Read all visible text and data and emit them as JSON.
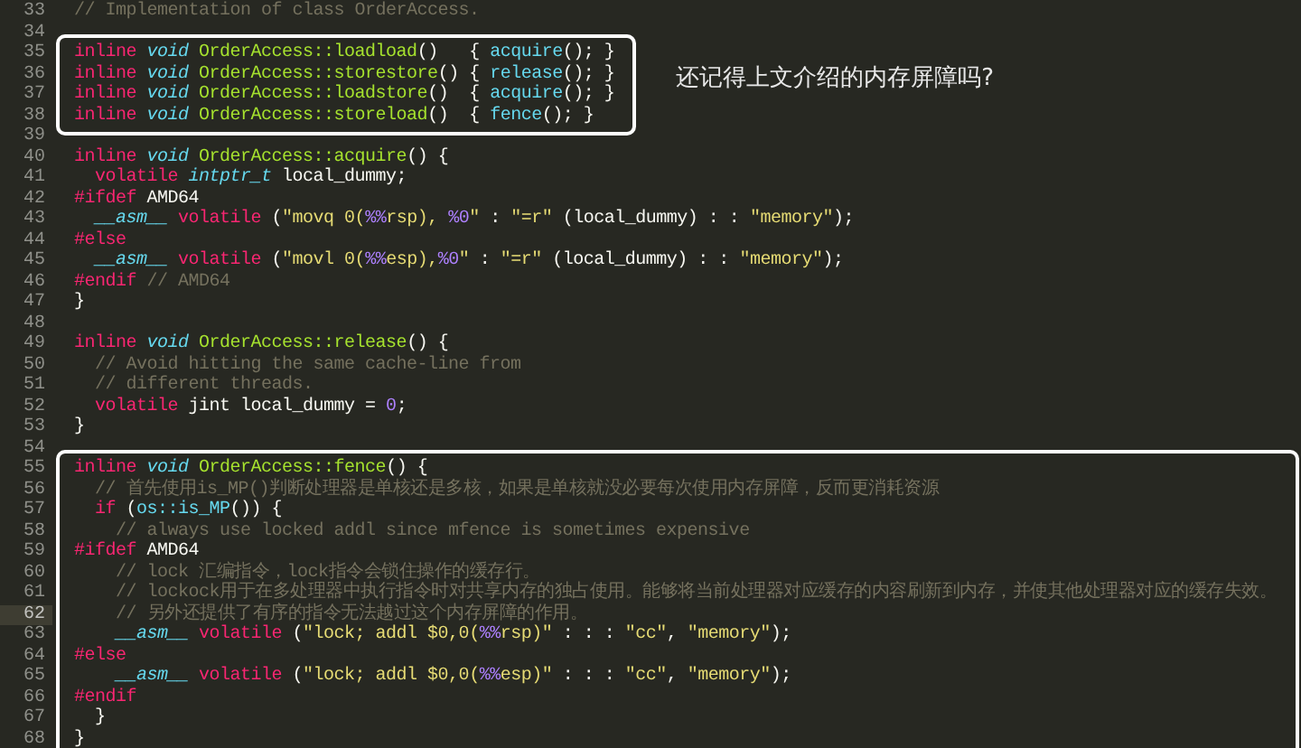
{
  "blocks": [
    {
      "framed": false,
      "lines": [
        {
          "number": "33",
          "current": false,
          "tokens": [
            {
              "kind": "comment",
              "text": "// Implementation of class OrderAccess."
            }
          ]
        },
        {
          "number": "34",
          "current": false
        }
      ]
    },
    {
      "framed": true,
      "note": "还记得上文介绍的内存屏障吗?",
      "lines": [
        {
          "number": "35",
          "current": false,
          "tokens": [
            {
              "kind": "keyword",
              "text": "inline "
            },
            {
              "kind": "type",
              "text": "void "
            },
            {
              "kind": "function",
              "text": "OrderAccess::loadload"
            },
            {
              "kind": "plain",
              "text": "()   { "
            },
            {
              "kind": "call",
              "text": "acquire"
            },
            {
              "kind": "plain",
              "text": "(); }"
            }
          ]
        },
        {
          "number": "36",
          "current": false,
          "tokens": [
            {
              "kind": "keyword",
              "text": "inline "
            },
            {
              "kind": "type",
              "text": "void "
            },
            {
              "kind": "function",
              "text": "OrderAccess::storestore"
            },
            {
              "kind": "plain",
              "text": "() { "
            },
            {
              "kind": "call",
              "text": "release"
            },
            {
              "kind": "plain",
              "text": "(); }"
            }
          ]
        },
        {
          "number": "37",
          "current": false,
          "tokens": [
            {
              "kind": "keyword",
              "text": "inline "
            },
            {
              "kind": "type",
              "text": "void "
            },
            {
              "kind": "function",
              "text": "OrderAccess::loadstore"
            },
            {
              "kind": "plain",
              "text": "()  { "
            },
            {
              "kind": "call",
              "text": "acquire"
            },
            {
              "kind": "plain",
              "text": "(); }"
            }
          ]
        },
        {
          "number": "38",
          "current": false,
          "tokens": [
            {
              "kind": "keyword",
              "text": "inline "
            },
            {
              "kind": "type",
              "text": "void "
            },
            {
              "kind": "function",
              "text": "OrderAccess::storeload"
            },
            {
              "kind": "plain",
              "text": "()  { "
            },
            {
              "kind": "call",
              "text": "fence"
            },
            {
              "kind": "plain",
              "text": "(); }"
            }
          ]
        }
      ]
    },
    {
      "framed": false,
      "lines": [
        {
          "number": "39",
          "current": false
        },
        {
          "number": "40",
          "current": false,
          "tokens": [
            {
              "kind": "keyword",
              "text": "inline "
            },
            {
              "kind": "type",
              "text": "void "
            },
            {
              "kind": "function",
              "text": "OrderAccess::acquire"
            },
            {
              "kind": "plain",
              "text": "() {"
            }
          ]
        },
        {
          "number": "41",
          "current": false,
          "tokens": [
            {
              "kind": "keyword",
              "text": "  volatile "
            },
            {
              "kind": "type",
              "text": "intptr_t "
            },
            {
              "kind": "plain",
              "text": "local_dummy;"
            }
          ]
        },
        {
          "number": "42",
          "current": false,
          "tokens": [
            {
              "kind": "keyword",
              "text": "#ifdef "
            },
            {
              "kind": "plain",
              "text": "AMD64"
            }
          ]
        },
        {
          "number": "43",
          "current": false,
          "tokens": [
            {
              "kind": "type",
              "text": "  __asm__ "
            },
            {
              "kind": "keyword",
              "text": "volatile "
            },
            {
              "kind": "plain",
              "text": "("
            },
            {
              "kind": "string",
              "text": "\"movq 0("
            },
            {
              "kind": "number",
              "text": "%%"
            },
            {
              "kind": "string",
              "text": "rsp), "
            },
            {
              "kind": "number",
              "text": "%0"
            },
            {
              "kind": "string",
              "text": "\""
            },
            {
              "kind": "plain",
              "text": " : "
            },
            {
              "kind": "string",
              "text": "\"=r\""
            },
            {
              "kind": "plain",
              "text": " (local_dummy) : : "
            },
            {
              "kind": "string",
              "text": "\"memory\""
            },
            {
              "kind": "plain",
              "text": ");"
            }
          ]
        },
        {
          "number": "44",
          "current": false,
          "tokens": [
            {
              "kind": "keyword",
              "text": "#else"
            }
          ]
        },
        {
          "number": "45",
          "current": false,
          "tokens": [
            {
              "kind": "type",
              "text": "  __asm__ "
            },
            {
              "kind": "keyword",
              "text": "volatile "
            },
            {
              "kind": "plain",
              "text": "("
            },
            {
              "kind": "string",
              "text": "\"movl 0("
            },
            {
              "kind": "number",
              "text": "%%"
            },
            {
              "kind": "string",
              "text": "esp),"
            },
            {
              "kind": "number",
              "text": "%0"
            },
            {
              "kind": "string",
              "text": "\""
            },
            {
              "kind": "plain",
              "text": " : "
            },
            {
              "kind": "string",
              "text": "\"=r\""
            },
            {
              "kind": "plain",
              "text": " (local_dummy) : : "
            },
            {
              "kind": "string",
              "text": "\"memory\""
            },
            {
              "kind": "plain",
              "text": ");"
            }
          ]
        },
        {
          "number": "46",
          "current": false,
          "tokens": [
            {
              "kind": "keyword",
              "text": "#endif"
            },
            {
              "kind": "comment",
              "text": " // AMD64"
            }
          ]
        },
        {
          "number": "47",
          "current": false,
          "tokens": [
            {
              "kind": "plain",
              "text": "}"
            }
          ]
        },
        {
          "number": "48",
          "current": false
        },
        {
          "number": "49",
          "current": false,
          "tokens": [
            {
              "kind": "keyword",
              "text": "inline "
            },
            {
              "kind": "type",
              "text": "void "
            },
            {
              "kind": "function",
              "text": "OrderAccess::release"
            },
            {
              "kind": "plain",
              "text": "() {"
            }
          ]
        },
        {
          "number": "50",
          "current": false,
          "tokens": [
            {
              "kind": "comment",
              "text": "  // Avoid hitting the same cache-line from"
            }
          ]
        },
        {
          "number": "51",
          "current": false,
          "tokens": [
            {
              "kind": "comment",
              "text": "  // different threads."
            }
          ]
        },
        {
          "number": "52",
          "current": false,
          "tokens": [
            {
              "kind": "keyword",
              "text": "  volatile"
            },
            {
              "kind": "plain",
              "text": " jint local_dummy = "
            },
            {
              "kind": "number",
              "text": "0"
            },
            {
              "kind": "plain",
              "text": ";"
            }
          ]
        },
        {
          "number": "53",
          "current": false,
          "tokens": [
            {
              "kind": "plain",
              "text": "}"
            }
          ]
        },
        {
          "number": "54",
          "current": false
        }
      ]
    },
    {
      "framed": true,
      "lines": [
        {
          "number": "55",
          "current": false,
          "tokens": [
            {
              "kind": "keyword",
              "text": "inline "
            },
            {
              "kind": "type",
              "text": "void "
            },
            {
              "kind": "function",
              "text": "OrderAccess::fence"
            },
            {
              "kind": "plain",
              "text": "() {"
            }
          ]
        },
        {
          "number": "56",
          "current": false,
          "tokens": [
            {
              "kind": "comment",
              "text": "  // 首先使用is_MP()判断处理器是单核还是多核，如果是单核就没必要每次使用内存屏障，反而更消耗资源"
            }
          ]
        },
        {
          "number": "57",
          "current": false,
          "tokens": [
            {
              "kind": "keyword",
              "text": "  if "
            },
            {
              "kind": "plain",
              "text": "("
            },
            {
              "kind": "call",
              "text": "os::is_MP"
            },
            {
              "kind": "plain",
              "text": "()) {"
            }
          ]
        },
        {
          "number": "58",
          "current": false,
          "tokens": [
            {
              "kind": "comment",
              "text": "    // always use locked addl since mfence is sometimes expensive"
            }
          ]
        },
        {
          "number": "59",
          "current": false,
          "tokens": [
            {
              "kind": "keyword",
              "text": "#ifdef "
            },
            {
              "kind": "plain",
              "text": "AMD64"
            }
          ]
        },
        {
          "number": "60",
          "current": false,
          "tokens": [
            {
              "kind": "comment",
              "text": "    // lock 汇编指令，lock指令会锁住操作的缓存行。"
            }
          ]
        },
        {
          "number": "61",
          "current": false,
          "tokens": [
            {
              "kind": "comment",
              "text": "    // lockock用于在多处理器中执行指令时对共享内存的独占使用。能够将当前处理器对应缓存的内容刷新到内存，并使其他处理器对应的缓存失效。"
            }
          ]
        },
        {
          "number": "62",
          "current": true,
          "tokens": [
            {
              "kind": "comment",
              "text": "    // 另外还提供了有序的指令无法越过这个内存屏障的作用。"
            }
          ]
        },
        {
          "number": "63",
          "current": false,
          "tokens": [
            {
              "kind": "type",
              "text": "    __asm__ "
            },
            {
              "kind": "keyword",
              "text": "volatile "
            },
            {
              "kind": "plain",
              "text": "("
            },
            {
              "kind": "string",
              "text": "\"lock; addl $0,0("
            },
            {
              "kind": "number",
              "text": "%%"
            },
            {
              "kind": "string",
              "text": "rsp)\""
            },
            {
              "kind": "plain",
              "text": " : : : "
            },
            {
              "kind": "string",
              "text": "\"cc\""
            },
            {
              "kind": "plain",
              "text": ", "
            },
            {
              "kind": "string",
              "text": "\"memory\""
            },
            {
              "kind": "plain",
              "text": ");"
            }
          ]
        },
        {
          "number": "64",
          "current": false,
          "tokens": [
            {
              "kind": "keyword",
              "text": "#else"
            }
          ]
        },
        {
          "number": "65",
          "current": false,
          "tokens": [
            {
              "kind": "type",
              "text": "    __asm__ "
            },
            {
              "kind": "keyword",
              "text": "volatile "
            },
            {
              "kind": "plain",
              "text": "("
            },
            {
              "kind": "string",
              "text": "\"lock; addl $0,0("
            },
            {
              "kind": "number",
              "text": "%%"
            },
            {
              "kind": "string",
              "text": "esp)\""
            },
            {
              "kind": "plain",
              "text": " : : : "
            },
            {
              "kind": "string",
              "text": "\"cc\""
            },
            {
              "kind": "plain",
              "text": ", "
            },
            {
              "kind": "string",
              "text": "\"memory\""
            },
            {
              "kind": "plain",
              "text": ");"
            }
          ]
        },
        {
          "number": "66",
          "current": false,
          "tokens": [
            {
              "kind": "keyword",
              "text": "#endif"
            }
          ]
        },
        {
          "number": "67",
          "current": false,
          "tokens": [
            {
              "kind": "plain",
              "text": "  }"
            }
          ]
        },
        {
          "number": "68",
          "current": false,
          "tokens": [
            {
              "kind": "plain",
              "text": "}"
            }
          ]
        }
      ]
    }
  ]
}
